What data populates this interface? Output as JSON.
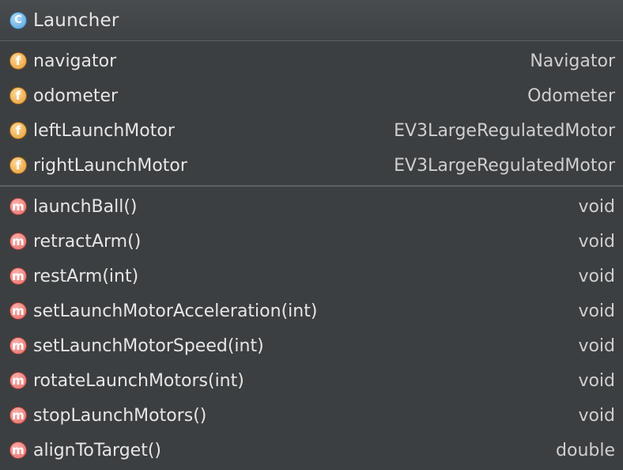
{
  "class": {
    "badge_letter": "C",
    "name": "Launcher",
    "icon": "class-icon"
  },
  "fields": [
    {
      "badge_letter": "f",
      "name": "navigator",
      "type": "Navigator",
      "icon": "field-icon"
    },
    {
      "badge_letter": "f",
      "name": "odometer",
      "type": "Odometer",
      "icon": "field-icon"
    },
    {
      "badge_letter": "f",
      "name": "leftLaunchMotor",
      "type": "EV3LargeRegulatedMotor",
      "icon": "field-icon"
    },
    {
      "badge_letter": "f",
      "name": "rightLaunchMotor",
      "type": "EV3LargeRegulatedMotor",
      "icon": "field-icon"
    }
  ],
  "methods": [
    {
      "badge_letter": "m",
      "name": "launchBall()",
      "type": "void",
      "icon": "method-icon"
    },
    {
      "badge_letter": "m",
      "name": "retractArm()",
      "type": "void",
      "icon": "method-icon"
    },
    {
      "badge_letter": "m",
      "name": "restArm(int)",
      "type": "void",
      "icon": "method-icon"
    },
    {
      "badge_letter": "m",
      "name": "setLaunchMotorAcceleration(int)",
      "type": "void",
      "icon": "method-icon"
    },
    {
      "badge_letter": "m",
      "name": "setLaunchMotorSpeed(int)",
      "type": "void",
      "icon": "method-icon"
    },
    {
      "badge_letter": "m",
      "name": "rotateLaunchMotors(int)",
      "type": "void",
      "icon": "method-icon"
    },
    {
      "badge_letter": "m",
      "name": "stopLaunchMotors()",
      "type": "void",
      "icon": "method-icon"
    },
    {
      "badge_letter": "m",
      "name": "alignToTarget()",
      "type": "double",
      "icon": "method-icon"
    }
  ],
  "colors": {
    "background": "#3c3f41",
    "divider": "#5e6163",
    "text": "#e6e6e6",
    "class_badge": "#4aa1dc",
    "field_badge": "#e49b2f",
    "method_badge": "#e46a66"
  }
}
